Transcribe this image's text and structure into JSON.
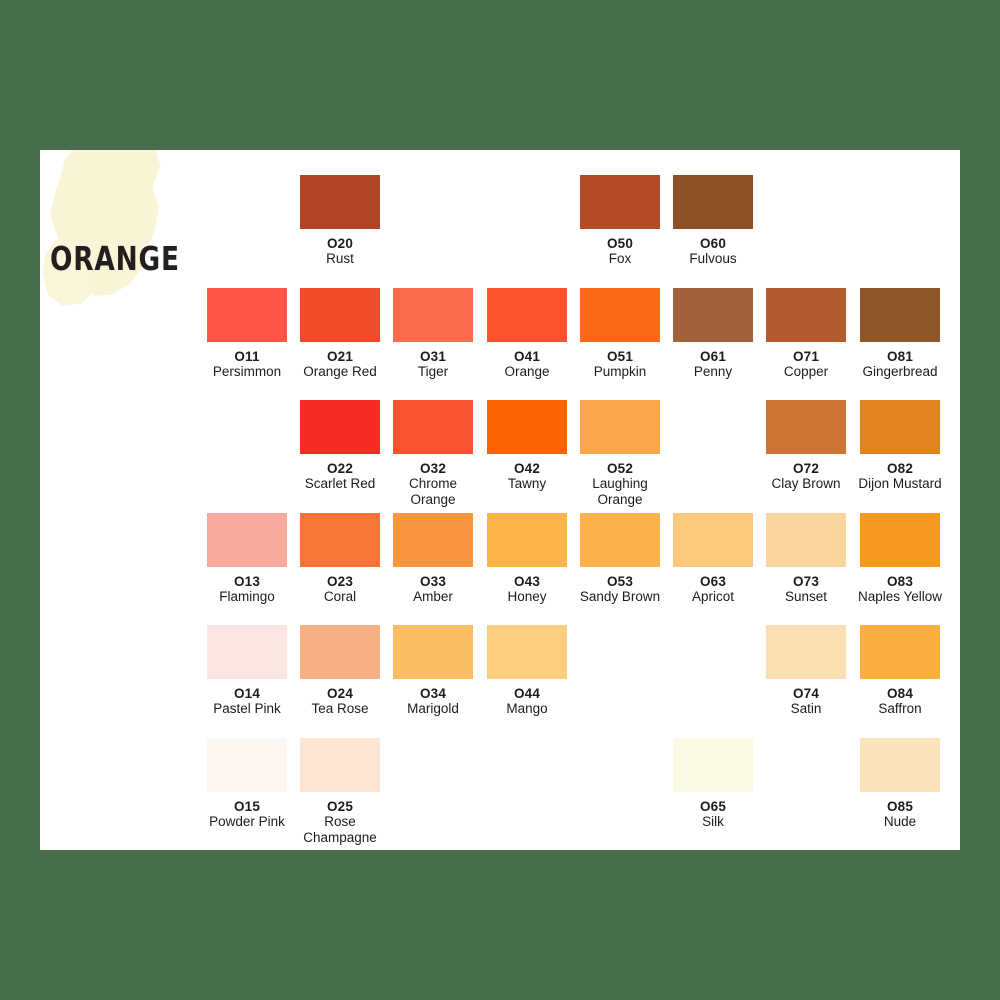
{
  "page": {
    "background_color": "#476E4C",
    "card_color": "#FFFFFF",
    "brush_color": "#FAF4D7",
    "title": "ORANGE",
    "text_color": "#1C1C1C"
  },
  "chart_data": {
    "type": "table",
    "title": "ORANGE",
    "columns": 8,
    "rows": 6,
    "swatches": [
      {
        "row": 0,
        "col": 2,
        "code": "O20",
        "name": "Rust",
        "hex": "#B14526"
      },
      {
        "row": 0,
        "col": 5,
        "code": "O50",
        "name": "Fox",
        "hex": "#B34B27"
      },
      {
        "row": 0,
        "col": 6,
        "code": "O60",
        "name": "Fulvous",
        "hex": "#8E5025"
      },
      {
        "row": 1,
        "col": 1,
        "code": "O11",
        "name": "Persimmon",
        "hex": "#FB5744"
      },
      {
        "row": 1,
        "col": 2,
        "code": "O21",
        "name": "Orange Red",
        "hex": "#F04A2B"
      },
      {
        "row": 1,
        "col": 3,
        "code": "O31",
        "name": "Tiger",
        "hex": "#FC6A4C"
      },
      {
        "row": 1,
        "col": 4,
        "code": "O41",
        "name": "Orange",
        "hex": "#FB5330"
      },
      {
        "row": 1,
        "col": 5,
        "code": "O51",
        "name": "Pumpkin",
        "hex": "#FB6A18"
      },
      {
        "row": 1,
        "col": 6,
        "code": "O61",
        "name": "Penny",
        "hex": "#A3623B"
      },
      {
        "row": 1,
        "col": 7,
        "code": "O71",
        "name": "Copper",
        "hex": "#B35C30"
      },
      {
        "row": 1,
        "col": 8,
        "code": "O81",
        "name": "Gingerbread",
        "hex": "#8E5629"
      },
      {
        "row": 2,
        "col": 2,
        "code": "O22",
        "name": "Scarlet Red",
        "hex": "#F82B22"
      },
      {
        "row": 2,
        "col": 3,
        "code": "O32",
        "name": "Chrome Orange",
        "hex": "#FA5331"
      },
      {
        "row": 2,
        "col": 4,
        "code": "O42",
        "name": "Tawny",
        "hex": "#FA6400"
      },
      {
        "row": 2,
        "col": 5,
        "code": "O52",
        "name": "Laughing Orange",
        "hex": "#FBA84C"
      },
      {
        "row": 2,
        "col": 7,
        "code": "O72",
        "name": "Clay Brown",
        "hex": "#CB7436"
      },
      {
        "row": 2,
        "col": 8,
        "code": "O82",
        "name": "Dijon Mustard",
        "hex": "#E1831E"
      },
      {
        "row": 3,
        "col": 1,
        "code": "O13",
        "name": "Flamingo",
        "hex": "#F8A99C"
      },
      {
        "row": 3,
        "col": 2,
        "code": "O23",
        "name": "Coral",
        "hex": "#F97537"
      },
      {
        "row": 3,
        "col": 3,
        "code": "O33",
        "name": "Amber",
        "hex": "#F9963F"
      },
      {
        "row": 3,
        "col": 4,
        "code": "O43",
        "name": "Honey",
        "hex": "#FBB549"
      },
      {
        "row": 3,
        "col": 5,
        "code": "O53",
        "name": "Sandy Brown",
        "hex": "#FBB24A"
      },
      {
        "row": 3,
        "col": 6,
        "code": "O63",
        "name": "Apricot",
        "hex": "#FBC87E"
      },
      {
        "row": 3,
        "col": 7,
        "code": "O73",
        "name": "Sunset",
        "hex": "#FBD5A0"
      },
      {
        "row": 3,
        "col": 8,
        "code": "O83",
        "name": "Naples Yellow",
        "hex": "#F99A20"
      },
      {
        "row": 4,
        "col": 1,
        "code": "O14",
        "name": "Pastel Pink",
        "hex": "#FBE6E2"
      },
      {
        "row": 4,
        "col": 2,
        "code": "O24",
        "name": "Tea Rose",
        "hex": "#F8AF85"
      },
      {
        "row": 4,
        "col": 3,
        "code": "O34",
        "name": "Marigold",
        "hex": "#FBBE64"
      },
      {
        "row": 4,
        "col": 4,
        "code": "O44",
        "name": "Mango",
        "hex": "#FBCE82"
      },
      {
        "row": 4,
        "col": 7,
        "code": "O74",
        "name": "Satin",
        "hex": "#FCDFB2"
      },
      {
        "row": 4,
        "col": 8,
        "code": "O84",
        "name": "Saffron",
        "hex": "#F9AE3E"
      },
      {
        "row": 5,
        "col": 1,
        "code": "O15",
        "name": "Powder Pink",
        "hex": "#FDF6F1"
      },
      {
        "row": 5,
        "col": 2,
        "code": "O25",
        "name": "Rose Champagne",
        "hex": "#FCE6D3"
      },
      {
        "row": 5,
        "col": 6,
        "code": "O65",
        "name": "Silk",
        "hex": "#FCFAE4"
      },
      {
        "row": 5,
        "col": 8,
        "code": "O85",
        "name": "Nude",
        "hex": "#FBE3BC"
      }
    ]
  }
}
